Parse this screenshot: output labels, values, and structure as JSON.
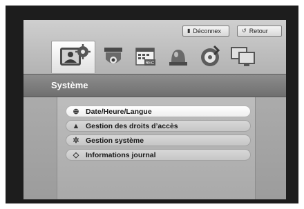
{
  "header": {
    "logout_label": "Déconnex",
    "back_label": "Retour"
  },
  "toolbar": {
    "icons": [
      "system-settings",
      "camera-settings",
      "recording-schedule",
      "event-alarm",
      "backup-disc",
      "network-settings"
    ],
    "selected": "system-settings"
  },
  "title": "Système",
  "menu": {
    "items": [
      {
        "label": "Date/Heure/Langue",
        "icon": "globe-icon",
        "selected": true
      },
      {
        "label": "Gestion des droits d’accès",
        "icon": "user-icon",
        "selected": false
      },
      {
        "label": "Gestion système",
        "icon": "gear-icon",
        "selected": false
      },
      {
        "label": "Informations journal",
        "icon": "diamond-icon",
        "selected": false
      }
    ]
  }
}
